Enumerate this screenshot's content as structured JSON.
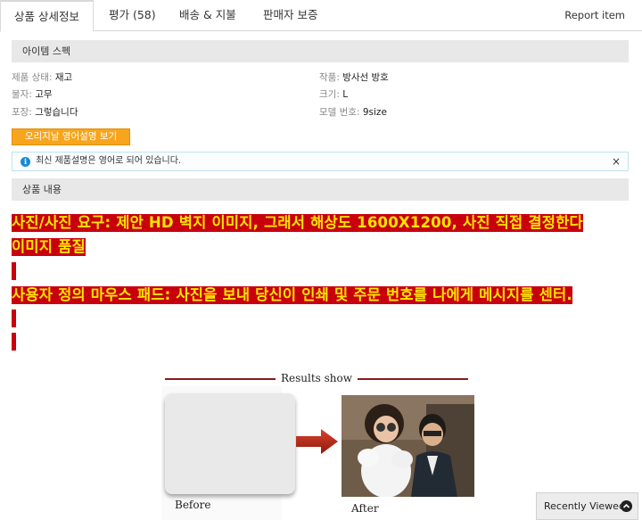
{
  "tabs": {
    "details": "상품 상세정보",
    "reviews": "평가 (58)",
    "shipping": "배송 & 지불",
    "guarantee": "판매자 보증"
  },
  "report_item": "Report item",
  "spec": {
    "section_title": "아이템 스펙",
    "items": [
      {
        "key": "제품 상태:",
        "value": "재고"
      },
      {
        "key": "작품:",
        "value": "방사선 방호"
      },
      {
        "key": "물자:",
        "value": "고무"
      },
      {
        "key": "크기:",
        "value": "L"
      },
      {
        "key": "포장:",
        "value": "그렇습니다"
      },
      {
        "key": "모델 번호:",
        "value": "9size"
      }
    ]
  },
  "original_button": "오리지날 영어설명 보기",
  "notice": {
    "icon": "info-icon",
    "text": "최신 제품설명은 영어로 되어 있습니다.",
    "close": "×"
  },
  "content": {
    "section_title": "상품 내용",
    "line1": "사진/사진 요구: 제안 HD 벽지 이미지, 그래서 해상도 1600X1200, 사진 직접 결정한다",
    "line2": "이미지 품질",
    "line3": "사용자 정의 마우스 패드: 사진을 보내 당신이 인쇄 및 주문 번호를 나에게 메시지를 센터.",
    "highlight_bg": "#c8000e",
    "highlight_text": "#ffe600"
  },
  "results": {
    "title": "Results show",
    "before": "Before",
    "after": "After"
  },
  "recently_viewed": "Recently Viewed",
  "recently_viewed_icon": "chevron-up-icon"
}
